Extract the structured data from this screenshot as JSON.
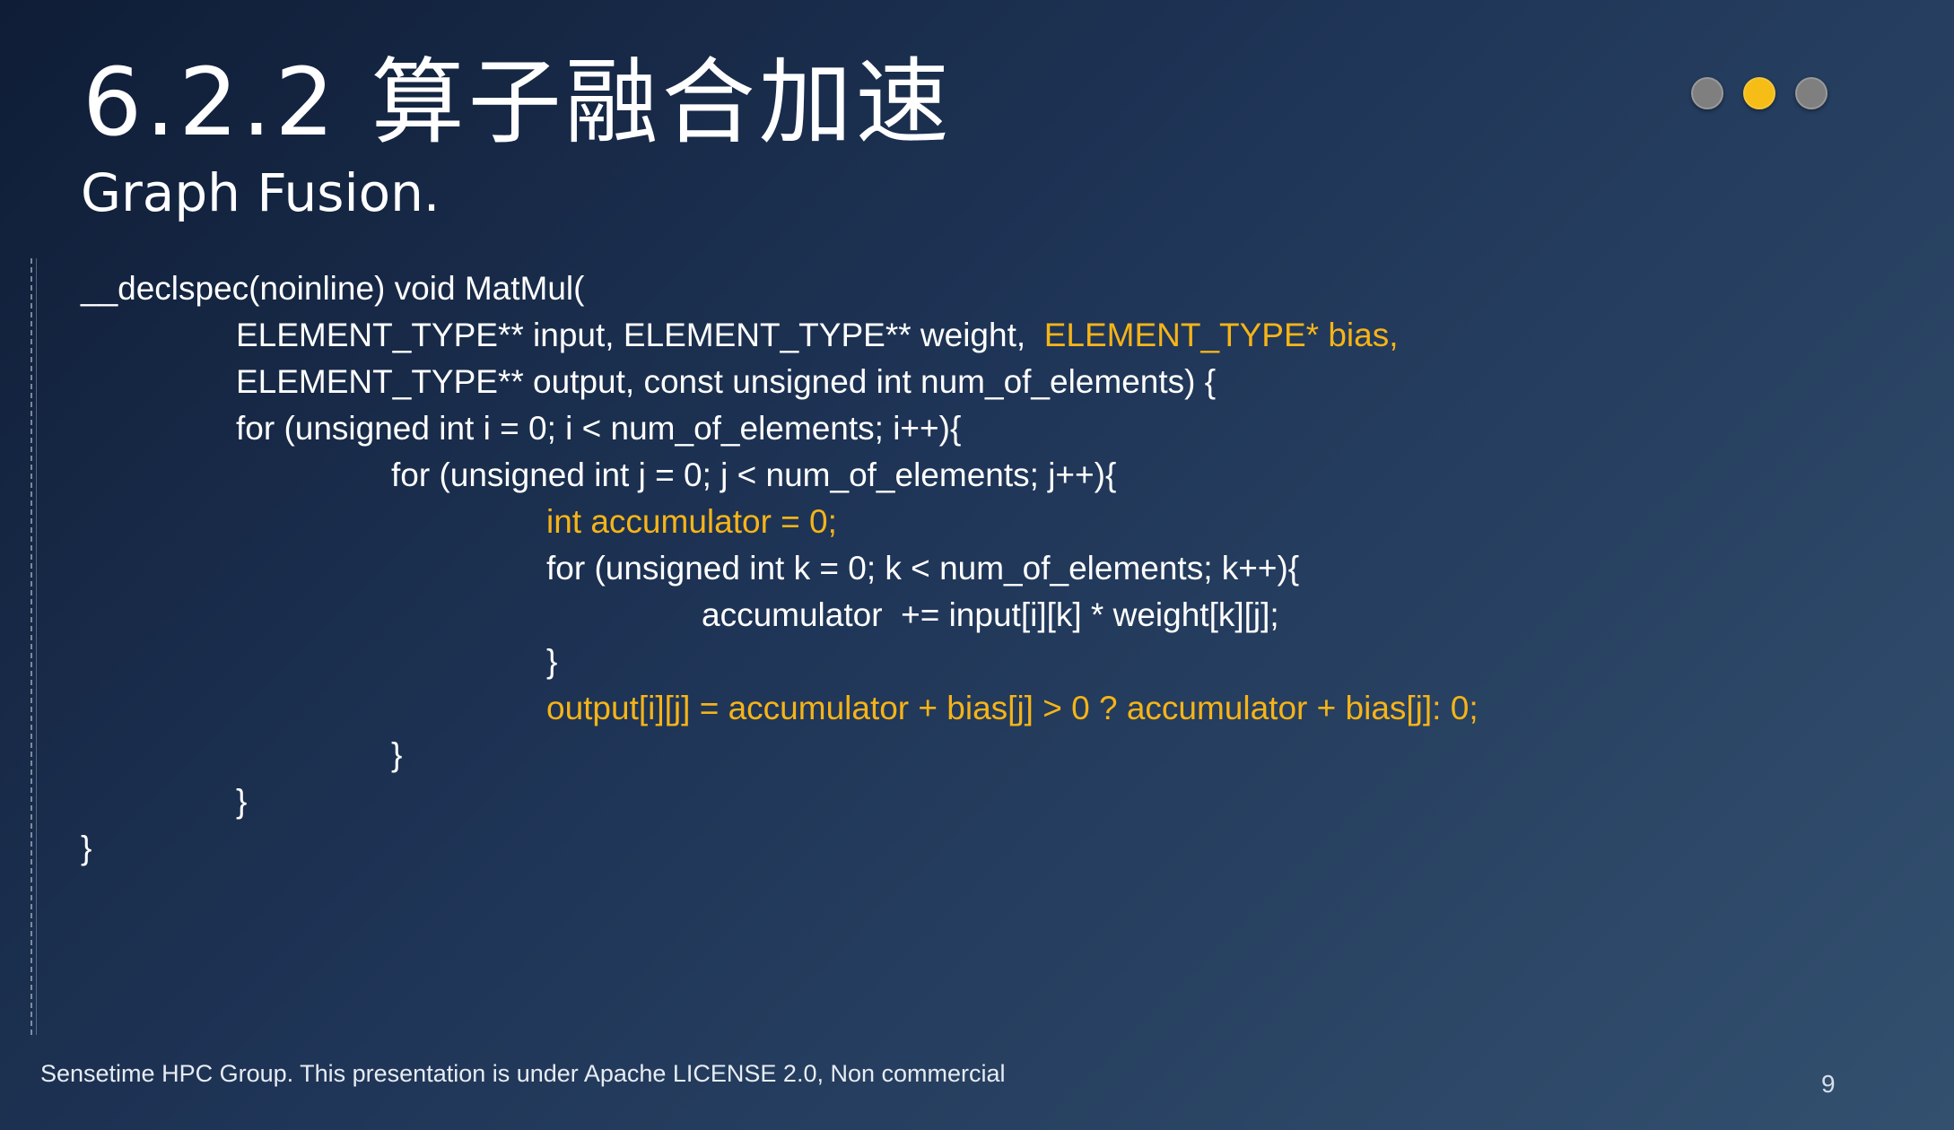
{
  "slide": {
    "title": "6.2.2 算子融合加速",
    "subtitle": "Graph Fusion.",
    "footer": "Sensetime HPC Group. This presentation is under Apache LICENSE 2.0, Non commercial",
    "page_number": "9",
    "progress_dots": {
      "total": 3,
      "active_index": 1
    },
    "colors": {
      "highlight": "#f6b417",
      "text": "#ffffff",
      "dot_active": "#f6bd16",
      "dot_inactive": "#7f7f7f"
    }
  },
  "code": {
    "line1": "__declspec(noinline) void MatMul(",
    "line2_a": "ELEMENT_TYPE** input, ELEMENT_TYPE** weight,  ",
    "line2_b": "ELEMENT_TYPE* bias,",
    "line3": "ELEMENT_TYPE** output, const unsigned int num_of_elements) {",
    "line4": "for (unsigned int i = 0; i < num_of_elements; i++){",
    "line5": "for (unsigned int j = 0; j < num_of_elements; j++){",
    "line6": "int accumulator = 0;",
    "line7": "for (unsigned int k = 0; k < num_of_elements; k++){",
    "line8": "accumulator  += input[i][k] * weight[k][j];",
    "line9": "}",
    "line10": "output[i][j] = accumulator + bias[j] > 0 ? accumulator + bias[j]: 0;",
    "line11": "}",
    "line12": "}",
    "line13": "}"
  }
}
